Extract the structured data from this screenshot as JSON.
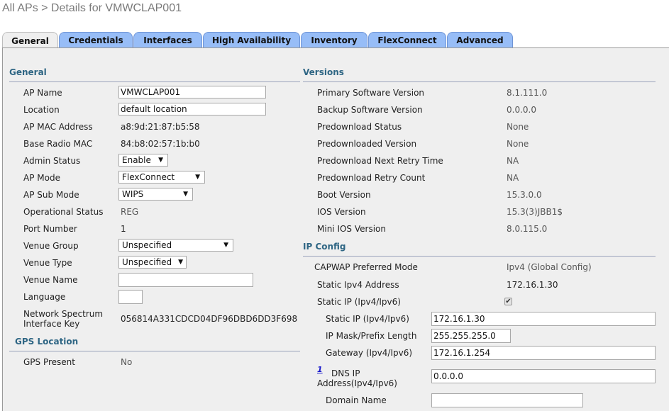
{
  "breadcrumb": "All APs > Details for VMWCLAP001",
  "tabs": [
    {
      "label": "General",
      "active": true
    },
    {
      "label": "Credentials"
    },
    {
      "label": "Interfaces"
    },
    {
      "label": "High Availability"
    },
    {
      "label": "Inventory"
    },
    {
      "label": "FlexConnect"
    },
    {
      "label": "Advanced"
    }
  ],
  "general": {
    "title": "General",
    "ap_name_label": "AP Name",
    "ap_name": "VMWCLAP001",
    "location_label": "Location",
    "location": "default location",
    "ap_mac_label": "AP MAC Address",
    "ap_mac": "a8:9d:21:87:b5:58",
    "base_radio_mac_label": "Base Radio MAC",
    "base_radio_mac": "84:b8:02:57:1b:b0",
    "admin_status_label": "Admin Status",
    "admin_status": "Enable",
    "ap_mode_label": "AP Mode",
    "ap_mode": "FlexConnect",
    "ap_sub_mode_label": "AP Sub Mode",
    "ap_sub_mode": "WIPS",
    "operational_status_label": "Operational Status",
    "operational_status": "REG",
    "port_number_label": "Port Number",
    "port_number": "1",
    "venue_group_label": "Venue Group",
    "venue_group": "Unspecified",
    "venue_type_label": "Venue Type",
    "venue_type": "Unspecified",
    "venue_name_label": "Venue Name",
    "venue_name": "",
    "language_label": "Language",
    "language": "",
    "nsi_key_label_1": "Network Spectrum",
    "nsi_key_label_2": "Interface Key",
    "nsi_key": "056814A331CDCD04DF96DBD6DD3F698"
  },
  "gps": {
    "title": "GPS Location",
    "gps_present_label": "GPS Present",
    "gps_present": "No"
  },
  "versions": {
    "title": "Versions",
    "rows": [
      {
        "label": "Primary Software Version",
        "value": "8.1.111.0"
      },
      {
        "label": "Backup Software Version",
        "value": "0.0.0.0"
      },
      {
        "label": "Predownload Status",
        "value": "None"
      },
      {
        "label": "Predownloaded Version",
        "value": "None"
      },
      {
        "label": "Predownload Next Retry Time",
        "value": "NA"
      },
      {
        "label": "Predownload Retry Count",
        "value": "NA"
      },
      {
        "label": "Boot Version",
        "value": "15.3.0.0"
      },
      {
        "label": "IOS Version",
        "value": "15.3(3)JBB1$"
      },
      {
        "label": "Mini IOS Version",
        "value": "8.0.115.0"
      }
    ]
  },
  "ip_config": {
    "title": "IP Config",
    "capwap_label": "CAPWAP Preferred Mode",
    "capwap": "Ipv4 (Global Config)",
    "static_ipv4_label": "Static Ipv4 Address",
    "static_ipv4": "172.16.1.30",
    "static_ip_chk_label": "Static IP (Ipv4/Ipv6)",
    "static_ip_checked": true,
    "check_glyph": "✔",
    "static_ip_label": "Static IP (Ipv4/Ipv6)",
    "static_ip": "172.16.1.30",
    "mask_label": "IP Mask/Prefix Length",
    "mask": "255.255.255.0",
    "gateway_label": "Gateway (Ipv4/Ipv6)",
    "gateway": "172.16.1.254",
    "dns_footnote": "1",
    "dns_label_1": "DNS IP",
    "dns_label_2": "Address(Ipv4/Ipv6)",
    "dns": "0.0.0.0",
    "domain_label": "Domain Name",
    "domain": ""
  }
}
